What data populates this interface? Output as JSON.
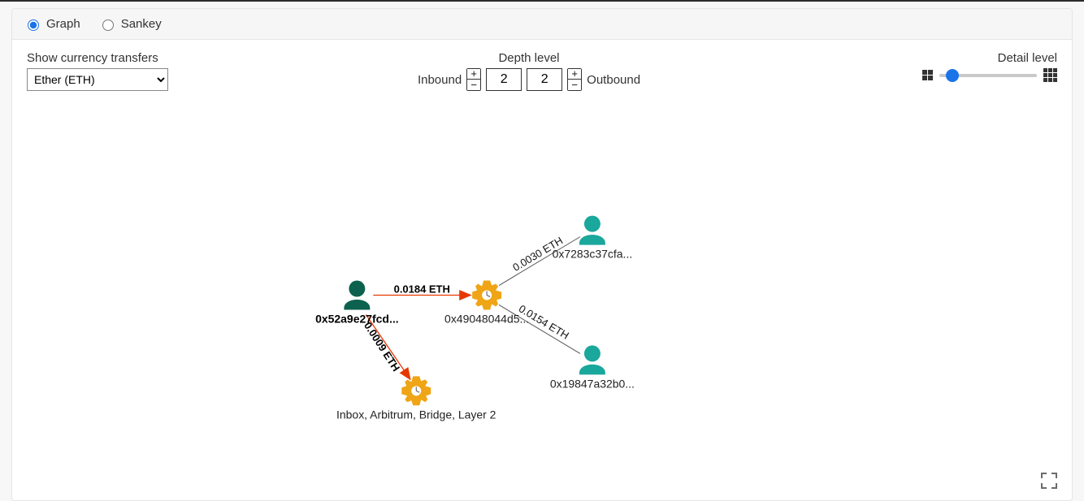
{
  "tabs": {
    "graph": "Graph",
    "sankey": "Sankey",
    "selected": "graph"
  },
  "currency": {
    "label": "Show currency transfers",
    "selected": "Ether (ETH)"
  },
  "depth": {
    "title": "Depth level",
    "inbound_label": "Inbound",
    "outbound_label": "Outbound",
    "inbound_value": "2",
    "outbound_value": "2",
    "plus": "+",
    "minus": "−"
  },
  "detail": {
    "title": "Detail level"
  },
  "nodes": {
    "center_user": {
      "label": "0x52a9e27fcd...",
      "color_person": "#0d624f"
    },
    "gear_main": {
      "label": "0x49048044d5...",
      "color": "#efa516"
    },
    "user_top": {
      "label": "0x7283c37cfa...",
      "color": "#1aa79c"
    },
    "user_bottom": {
      "label": "0x19847a32b0...",
      "color": "#1aa79c"
    },
    "gear_inbox": {
      "label": "Inbox, Arbitrum, Bridge, Layer 2",
      "color": "#efa516"
    }
  },
  "edges": {
    "e1": "0.0184 ETH",
    "e2": "0.0009 ETH",
    "e3": "0.0030 ETH",
    "e4": "0.0154 ETH"
  }
}
